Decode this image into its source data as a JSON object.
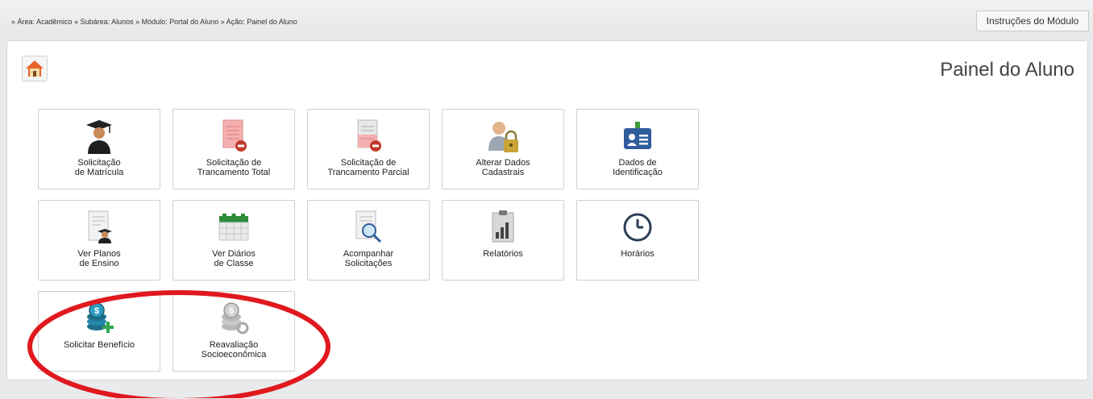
{
  "breadcrumb": "» Área: Acadêmico » Subárea: Alunos » Módulo: Portal do Aluno » Ação: Painel do Aluno",
  "instructions_button": "Instruções do Módulo",
  "page_title": "Painel do Aluno",
  "home_icon": "home-icon",
  "tiles": [
    {
      "label": "Solicitação\nde Matrícula",
      "icon": "graduate-icon"
    },
    {
      "label": "Solicitação de\nTrancamento Total",
      "icon": "document-remove-icon"
    },
    {
      "label": "Solicitação de\nTrancamento Parcial",
      "icon": "document-partial-remove-icon"
    },
    {
      "label": "Alterar Dados\nCadastrais",
      "icon": "user-lock-icon"
    },
    {
      "label": "Dados de\nIdentificação",
      "icon": "id-card-icon"
    },
    {
      "label": "Ver Planos\nde Ensino",
      "icon": "document-graduate-icon"
    },
    {
      "label": "Ver Diários\nde Classe",
      "icon": "calendar-icon"
    },
    {
      "label": "Acompanhar\nSolicitações",
      "icon": "document-search-icon"
    },
    {
      "label": "Relatórios",
      "icon": "report-chart-icon"
    },
    {
      "label": "Horários",
      "icon": "clock-icon"
    },
    {
      "label": "Solicitar Benefício",
      "icon": "coins-add-icon"
    },
    {
      "label": "Reavaliação\nSocioeconômica",
      "icon": "coins-refresh-icon"
    }
  ],
  "colors": {
    "highlight_ellipse": "#e0191f",
    "tile_border": "#cfcfcf",
    "accent_blue": "#2f5c9b",
    "accent_green": "#3c9b3c"
  }
}
